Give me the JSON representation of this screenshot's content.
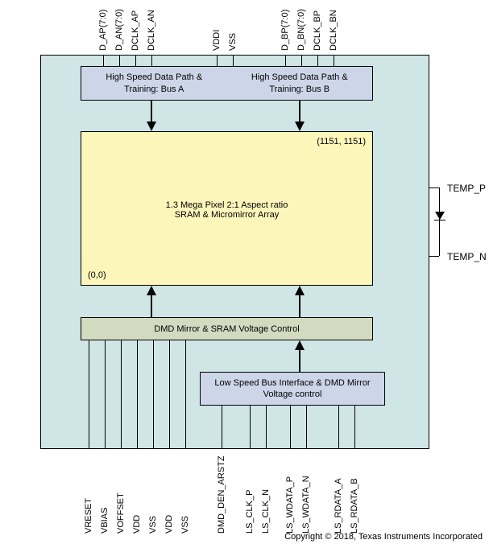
{
  "blocks": {
    "hsdp_a": {
      "line1": "High Speed Data Path &",
      "line2": "Training:  Bus A"
    },
    "hsdp_b": {
      "line1": "High Speed Data Path &",
      "line2": "Training:  Bus B"
    },
    "sram": {
      "line1": "1.3 Mega Pixel 2:1 Aspect ratio",
      "line2": "SRAM & Micromirror Array",
      "coord_tr": "(1151, 1151)",
      "coord_bl": "(0,0)"
    },
    "voltage": {
      "label": "DMD Mirror & SRAM Voltage Control"
    },
    "low_speed": {
      "line1": "Low Speed Bus Interface & DMD Mirror",
      "line2": "Voltage control"
    }
  },
  "pins": {
    "top": [
      "D_AP(7:0)",
      "D_AN(7:0)",
      "DCLK_AP",
      "DCLK_AN",
      "VDDI",
      "VSS",
      "D_BP(7:0)",
      "D_BN(7:0)",
      "DCLK_BP",
      "DCLK_BN"
    ],
    "bottom": [
      "VRESET",
      "VBIAS",
      "VOFFSET",
      "VDD",
      "VSS",
      "VDD",
      "VSS",
      "DMD_DEN_ARSTZ",
      "LS_CLK_P",
      "LS_CLK_N",
      "LS_WDATA_P",
      "LS_WDATA_N",
      "LS_RDATA_A",
      "LS_RDATA_B"
    ],
    "right": [
      "TEMP_P",
      "TEMP_N"
    ]
  },
  "copyright": "Copyright © 2018, Texas Instruments Incorporated"
}
